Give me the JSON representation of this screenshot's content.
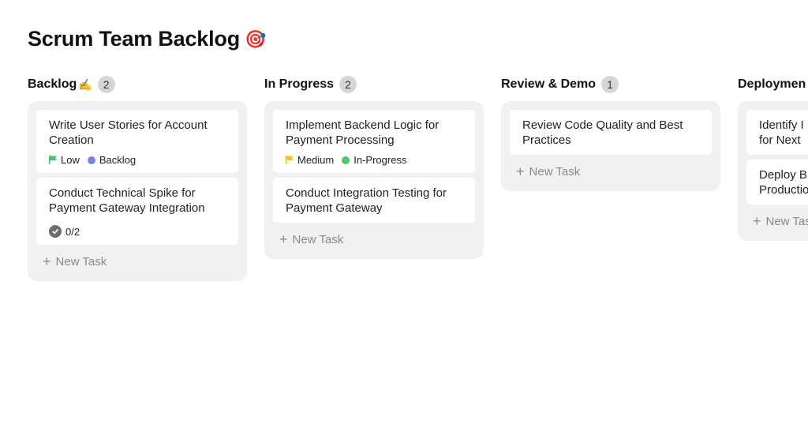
{
  "page": {
    "title": "Scrum Team Backlog",
    "title_emoji": "🎯"
  },
  "colors": {
    "priority_low": "#4cc46c",
    "priority_medium": "#f2c230",
    "status_backlog": "#7b83e0",
    "status_in_progress": "#4ec66a",
    "checklist_icon": "#6e6e6e"
  },
  "new_task_label": "New Task",
  "columns": [
    {
      "title": "Backlog",
      "emoji": "✍️",
      "count": "2",
      "cards": [
        {
          "title": "Write User Stories for Account Creation",
          "priority": "Low",
          "status": "Backlog"
        },
        {
          "title": "Conduct Technical Spike for Payment Gateway Integration",
          "checklist": "0/2"
        }
      ]
    },
    {
      "title": "In Progress",
      "emoji": "",
      "count": "2",
      "cards": [
        {
          "title": "Implement Backend Logic for Payment Processing",
          "priority": "Medium",
          "status": "In-Progress"
        },
        {
          "title": "Conduct Integration Testing for Payment Gateway"
        }
      ]
    },
    {
      "title": "Review & Demo",
      "emoji": "",
      "count": "1",
      "cards": [
        {
          "title": "Review Code Quality and Best Practices"
        }
      ]
    },
    {
      "title": "Deploymen",
      "emoji": "",
      "count": "",
      "cards": [
        {
          "title": "Identify I for Next"
        },
        {
          "title": "Deploy B Productio"
        }
      ]
    }
  ]
}
